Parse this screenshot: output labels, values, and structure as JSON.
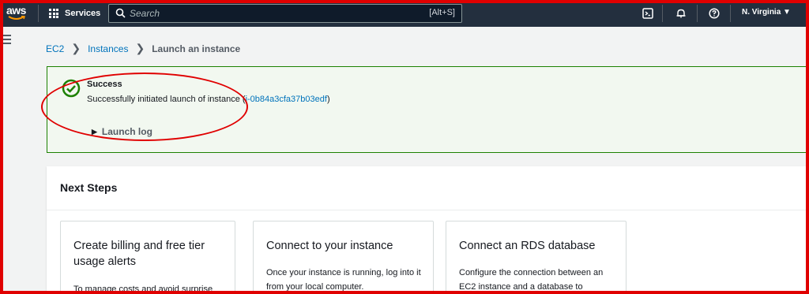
{
  "topnav": {
    "logo_text": "aws",
    "services_label": "Services",
    "search_placeholder": "Search",
    "search_shortcut": "[Alt+S]",
    "region": "N. Virginia ▼"
  },
  "breadcrumb": {
    "items": [
      "EC2",
      "Instances"
    ],
    "current": "Launch an instance"
  },
  "alert": {
    "title": "Success",
    "message": "Successfully initiated launch of instance (",
    "instance_id": "i-0b84a3cfa37b03edf",
    "message_end": ")",
    "log_label": "Launch log"
  },
  "next_steps": {
    "title": "Next Steps",
    "cards": [
      {
        "title": "Create billing and free tier usage alerts",
        "desc": "To manage costs and avoid surprise"
      },
      {
        "title": "Connect to your instance",
        "desc": "Once your instance is running, log into it from your local computer."
      },
      {
        "title": "Connect an RDS database",
        "desc": "Configure the connection between an EC2 instance and a database to"
      }
    ]
  },
  "colors": {
    "nav_bg": "#232f3e",
    "link": "#0073bb",
    "success_border": "#1d8102",
    "annotation": "#e00000"
  }
}
